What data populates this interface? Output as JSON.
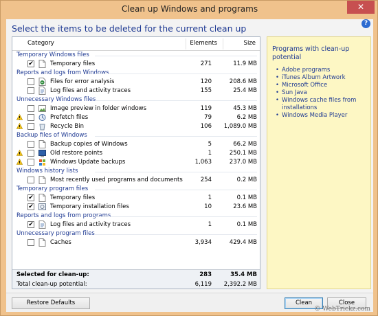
{
  "window": {
    "title": "Clean up Windows and programs",
    "close_glyph": "✕"
  },
  "heading": "Select the items to be deleted for the current clean up",
  "help_glyph": "?",
  "columns": {
    "category": "Category",
    "elements": "Elements",
    "size": "Size"
  },
  "groups": [
    {
      "label": "Temporary Windows files",
      "rows": [
        {
          "name": "Temporary files",
          "elements": "271",
          "size": "11.9 MB",
          "checked": true,
          "warn": false,
          "icon": "file-icon"
        }
      ]
    },
    {
      "label": "Reports and logs from Windows",
      "rows": [
        {
          "name": "Files for error analysis",
          "elements": "120",
          "size": "208.6 MB",
          "checked": false,
          "warn": false,
          "icon": "error-report-icon"
        },
        {
          "name": "Log files and activity traces",
          "elements": "155",
          "size": "25.4 MB",
          "checked": false,
          "warn": false,
          "icon": "log-file-icon"
        }
      ]
    },
    {
      "label": "Unnecessary Windows files",
      "rows": [
        {
          "name": "Image preview in folder windows",
          "elements": "119",
          "size": "45.3 MB",
          "checked": false,
          "warn": false,
          "icon": "image-preview-icon"
        },
        {
          "name": "Prefetch files",
          "elements": "79",
          "size": "6.2 MB",
          "checked": false,
          "warn": true,
          "icon": "prefetch-icon"
        },
        {
          "name": "Recycle Bin",
          "elements": "106",
          "size": "1,089.0 MB",
          "checked": false,
          "warn": true,
          "icon": "recycle-bin-icon"
        }
      ]
    },
    {
      "label": "Backup files of Windows",
      "rows": [
        {
          "name": "Backup copies of Windows",
          "elements": "5",
          "size": "66.2 MB",
          "checked": false,
          "warn": false,
          "icon": "file-icon"
        },
        {
          "name": "Old restore points",
          "elements": "1",
          "size": "250.1 MB",
          "checked": false,
          "warn": true,
          "icon": "restore-point-icon"
        },
        {
          "name": "Windows Update backups",
          "elements": "1,063",
          "size": "237.0 MB",
          "checked": false,
          "warn": true,
          "icon": "windows-update-icon"
        }
      ]
    },
    {
      "label": "Windows history lists",
      "rows": [
        {
          "name": "Most recently used programs and documents",
          "elements": "254",
          "size": "0.2 MB",
          "checked": false,
          "warn": false,
          "icon": "file-icon"
        }
      ]
    },
    {
      "label": "Temporary program files",
      "rows": [
        {
          "name": "Temporary files",
          "elements": "1",
          "size": "0.1 MB",
          "checked": true,
          "warn": false,
          "icon": "file-icon"
        },
        {
          "name": "Temporary installation files",
          "elements": "10",
          "size": "23.6 MB",
          "checked": true,
          "warn": false,
          "icon": "installer-icon"
        }
      ]
    },
    {
      "label": "Reports and logs from programs",
      "rows": [
        {
          "name": "Log files and activity traces",
          "elements": "1",
          "size": "0.1 MB",
          "checked": true,
          "warn": false,
          "icon": "log-file-icon"
        }
      ]
    },
    {
      "label": "Unnecessary program files",
      "rows": [
        {
          "name": "Caches",
          "elements": "3,934",
          "size": "429.4 MB",
          "checked": false,
          "warn": false,
          "icon": "file-icon"
        }
      ]
    }
  ],
  "totals": {
    "selected_label": "Selected for clean-up:",
    "selected_elements": "283",
    "selected_size": "35.4 MB",
    "total_label": "Total clean-up potential:",
    "total_elements": "6,119",
    "total_size": "2,392.2 MB"
  },
  "side_panel": {
    "title": "Programs with clean-up potential",
    "items": [
      "Adobe programs",
      "iTunes Album Artwork",
      "Microsoft Office",
      "Sun Java",
      "Windows cache files from installations",
      "Windows Media Player"
    ]
  },
  "buttons": {
    "restore": "Restore Defaults",
    "clean": "Clean",
    "close": "Close"
  },
  "watermark": "© WebTrickz.com",
  "colors": {
    "titlebar": "#f0c28c",
    "heading": "#1f3a93",
    "side_panel_bg": "#fdf7c4",
    "close_button": "#c75050"
  }
}
